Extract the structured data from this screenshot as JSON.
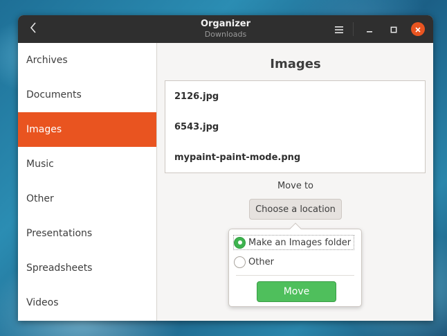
{
  "window": {
    "title": "Organizer",
    "subtitle": "Downloads"
  },
  "titlebar": {
    "back_icon": "chevron-left-icon",
    "menu_icon": "hamburger-menu-icon",
    "minimize_icon": "minimize-icon",
    "maximize_icon": "maximize-icon",
    "close_icon": "close-icon",
    "close_color": "#e95420"
  },
  "sidebar": {
    "items": [
      {
        "label": "Archives"
      },
      {
        "label": "Documents"
      },
      {
        "label": "Images",
        "active": true
      },
      {
        "label": "Music"
      },
      {
        "label": "Other"
      },
      {
        "label": "Presentations"
      },
      {
        "label": "Spreadsheets"
      },
      {
        "label": "Videos"
      }
    ],
    "active_color": "#e95420"
  },
  "main": {
    "title": "Images",
    "files": [
      {
        "name": "2126.jpg"
      },
      {
        "name": "6543.jpg"
      },
      {
        "name": "mypaint-paint-mode.png"
      }
    ],
    "move_to_label": "Move to",
    "choose_location_label": "Choose a location"
  },
  "popover": {
    "options": [
      {
        "label": "Make an Images folder",
        "selected": true
      },
      {
        "label": "Other",
        "selected": false
      }
    ],
    "move_button_label": "Move",
    "move_button_color": "#4fbf5c"
  }
}
